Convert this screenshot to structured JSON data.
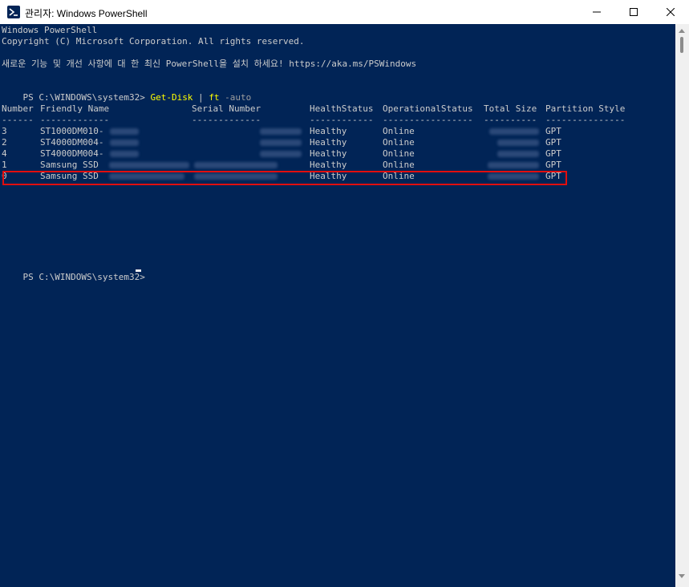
{
  "window": {
    "title": "관리자: Windows PowerShell",
    "icon": "powershell-icon",
    "buttons": [
      "minimize-icon",
      "maximize-icon",
      "close-icon"
    ]
  },
  "terminal": {
    "intro": [
      "Windows PowerShell",
      "Copyright (C) Microsoft Corporation. All rights reserved.",
      "새로운 기능 및 개선 사항에 대 한 최신 PowerShell을 설치 하세요! https://aka.ms/PSWindows"
    ],
    "prompt": "PS C:\\WINDOWS\\system32> ",
    "command": {
      "name": "Get-Disk",
      "pipe": " | ",
      "fmt": "ft",
      "param": " -auto"
    },
    "table": {
      "headers": [
        "Number",
        "Friendly Name",
        "Serial Number",
        "HealthStatus",
        "OperationalStatus",
        "Total Size",
        "Partition Style"
      ],
      "underlines": [
        "------",
        "-------------",
        "-------------",
        "------------",
        "-----------------",
        "----------",
        "---------------"
      ],
      "rows": [
        {
          "number": "3",
          "name": "ST1000DM010-",
          "health": "Healthy",
          "status": "Online",
          "style": "GPT"
        },
        {
          "number": "2",
          "name": "ST4000DM004-",
          "health": "Healthy",
          "status": "Online",
          "style": "GPT"
        },
        {
          "number": "4",
          "name": "ST4000DM004-",
          "health": "Healthy",
          "status": "Online",
          "style": "GPT"
        },
        {
          "number": "1",
          "name": "Samsung SSD",
          "health": "Healthy",
          "status": "Online",
          "style": "GPT"
        },
        {
          "number": "0",
          "name": "Samsung SSD",
          "health": "Healthy",
          "status": "Online",
          "style": "GPT"
        }
      ]
    },
    "final_prompt": "PS C:\\WINDOWS\\system32> "
  },
  "colors": {
    "background": "#012456",
    "text": "#cccccc",
    "command": "#ffff00",
    "parameter": "#9e9e9e",
    "highlight": "#e20e0e"
  }
}
